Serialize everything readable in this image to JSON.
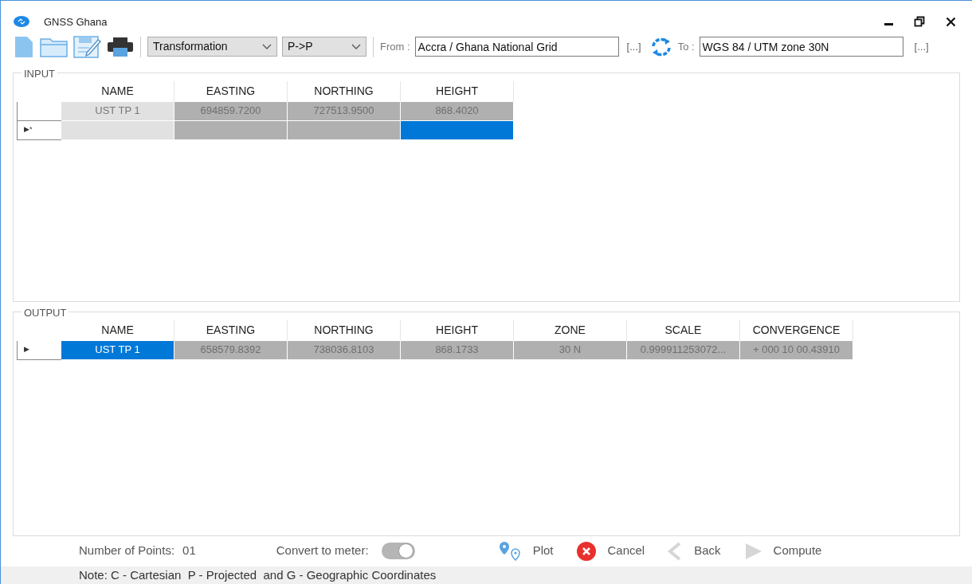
{
  "window": {
    "title": "GNSS Ghana"
  },
  "toolbar": {
    "mode": "Transformation",
    "direction": "P->P",
    "from_label": "From :",
    "from_value": "Accra / Ghana National Grid",
    "from_browse": "[...]",
    "to_label": "To :",
    "to_value": "WGS 84 / UTM zone 30N",
    "to_browse": "[...]"
  },
  "input": {
    "title": "INPUT",
    "columns": [
      "NAME",
      "EASTING",
      "NORTHING",
      "HEIGHT"
    ],
    "rows": [
      {
        "marker": "",
        "cells": [
          {
            "text": "UST TP 1",
            "selected": false
          },
          {
            "text": "694859.7200",
            "selected": false
          },
          {
            "text": "727513.9500",
            "selected": false
          },
          {
            "text": "868.4020",
            "selected": false
          }
        ]
      },
      {
        "marker": "▶*",
        "cells": [
          {
            "text": "",
            "selected": false
          },
          {
            "text": "",
            "selected": false
          },
          {
            "text": "",
            "selected": false
          },
          {
            "text": "",
            "selected": true
          }
        ]
      }
    ]
  },
  "output": {
    "title": "OUTPUT",
    "columns": [
      "NAME",
      "EASTING",
      "NORTHING",
      "HEIGHT",
      "ZONE",
      "SCALE",
      "CONVERGENCE"
    ],
    "rows": [
      {
        "marker": "▶",
        "cells": [
          {
            "text": "UST TP 1",
            "selected": true
          },
          {
            "text": "658579.8392",
            "selected": false
          },
          {
            "text": "738036.8103",
            "selected": false
          },
          {
            "text": "868.1733",
            "selected": false
          },
          {
            "text": "30 N",
            "selected": false
          },
          {
            "text": "0.999911253072...",
            "selected": false
          },
          {
            "text": "+ 000 10 00.43910",
            "selected": false
          }
        ]
      }
    ]
  },
  "footer": {
    "points_label": "Number of Points:",
    "points_value": "01",
    "convert_label": "Convert to meter:",
    "convert_on": true,
    "buttons": [
      {
        "kind": "plot",
        "label": "Plot",
        "disabled": false
      },
      {
        "kind": "cancel",
        "label": "Cancel",
        "disabled": false
      },
      {
        "kind": "back",
        "label": "Back",
        "disabled": true
      },
      {
        "kind": "compute",
        "label": "Compute",
        "disabled": true
      }
    ]
  },
  "note": "Note: C - Cartesian  P - Projected  and G - Geographic Coordinates"
}
